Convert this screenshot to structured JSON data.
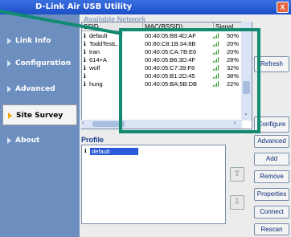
{
  "window": {
    "title": "D-Link Air USB Utility",
    "close_label": "X"
  },
  "sidebar": {
    "items": [
      {
        "label": "Link Info",
        "active": false
      },
      {
        "label": "Configuration",
        "active": false
      },
      {
        "label": "Advanced",
        "active": false
      },
      {
        "label": "Site Survey",
        "active": true
      },
      {
        "label": "About",
        "active": false
      }
    ]
  },
  "survey": {
    "section_label": "Available Network",
    "columns": [
      "SSID",
      "MAC(BSSID)",
      "Signal"
    ],
    "rows": [
      {
        "ssid": "default",
        "mac": "00:40:05:B8:4D:AF",
        "signal": "50%"
      },
      {
        "ssid": "ToddTestL...",
        "mac": "00:80:C8:1B:34:8B",
        "signal": "20%"
      },
      {
        "ssid": "tran",
        "mac": "00:40:05:CA:7B:E6",
        "signal": "20%"
      },
      {
        "ssid": "614+A",
        "mac": "00:40:05:B6:3D:4F",
        "signal": "28%"
      },
      {
        "ssid": "wolf",
        "mac": "00:40:05:C7:39:F8",
        "signal": "32%"
      },
      {
        "ssid": "",
        "mac": "00:40:05:B1:2D:45",
        "signal": "38%"
      },
      {
        "ssid": "hung",
        "mac": "00:40:05:BA:5B:DB",
        "signal": "22%"
      }
    ]
  },
  "profile": {
    "section_label": "Profile",
    "items": [
      "default"
    ]
  },
  "buttons": {
    "refresh": "Refresh",
    "configure": "Configure",
    "advanced": "Advanced",
    "add": "Add",
    "remove": "Remove",
    "properties": "Properties",
    "connect": "Connect",
    "rescan": "Rescan"
  },
  "colors": {
    "titlebar": "#1c4fc8",
    "sidebar": "#6d8fbf",
    "callout": "#138a72",
    "selection": "#2a5ad8"
  }
}
